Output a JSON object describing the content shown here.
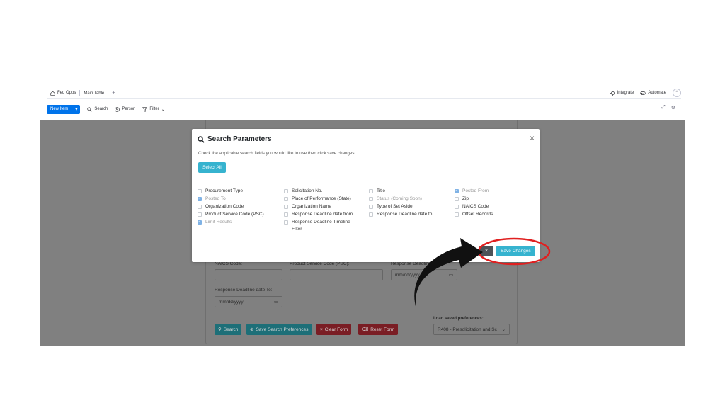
{
  "tabs": {
    "board_name": "Fed Opps",
    "main_table": "Main Table",
    "add": "+",
    "integrate": "Integrate",
    "automate": "Automate",
    "collapse": "^"
  },
  "toolbar": {
    "new_item": "New Item",
    "search": "Search",
    "person": "Person",
    "filter": "Filter"
  },
  "form": {
    "naics_label": "NAICS Code:",
    "psc_label": "Product Service Code (PSC):",
    "response_from_label": "Response Deadline",
    "date_placeholder": "mm/dd/yyyy",
    "response_to_label": "Response Deadline date To:",
    "load_prefs_label": "Load saved preferences:",
    "prefs_value": "R408 - Presolicitation and Sc",
    "search_btn": "Search",
    "save_prefs_btn": "Save Search Preferences",
    "clear_btn": "Clear Form",
    "reset_btn": "Reset Form"
  },
  "modal": {
    "title": "Search Parameters",
    "close": "×",
    "description": "Check the applicable search fields you would like to use then click save changes.",
    "select_all": "Select All",
    "close_button": "×",
    "save_button": "Save Changes",
    "options": [
      {
        "label": "Procurement Type",
        "checked": false,
        "disabled": false
      },
      {
        "label": "Posted To",
        "checked": true,
        "disabled": true
      },
      {
        "label": "Organization Code",
        "checked": false,
        "disabled": false
      },
      {
        "label": "Product Service Code (PSC)",
        "checked": false,
        "disabled": false
      },
      {
        "label": "Limit Results",
        "checked": true,
        "disabled": true
      },
      {
        "label": "Solicitation No.",
        "checked": false,
        "disabled": false
      },
      {
        "label": "Place of Performance (State)",
        "checked": false,
        "disabled": false
      },
      {
        "label": "Organization Name",
        "checked": false,
        "disabled": false
      },
      {
        "label": "Response Deadline date from",
        "checked": false,
        "disabled": false
      },
      {
        "label": "Response Deadline Timeline Filter",
        "checked": false,
        "disabled": false
      },
      {
        "label": "Title",
        "checked": false,
        "disabled": false
      },
      {
        "label": "Status (Coming Soon)",
        "checked": false,
        "disabled": true
      },
      {
        "label": "Type of Set Aside",
        "checked": false,
        "disabled": false
      },
      {
        "label": "Response Deadline date to",
        "checked": false,
        "disabled": false
      },
      {
        "label": "Posted From",
        "checked": true,
        "disabled": true
      },
      {
        "label": "Zip",
        "checked": false,
        "disabled": false
      },
      {
        "label": "NAICS Code",
        "checked": false,
        "disabled": false
      },
      {
        "label": "Offset Records",
        "checked": false,
        "disabled": false
      }
    ]
  },
  "colors": {
    "accent_blue": "#0073ea",
    "teal": "#36b3cf",
    "annotation_red": "#e02020",
    "arrow": "#111111"
  }
}
